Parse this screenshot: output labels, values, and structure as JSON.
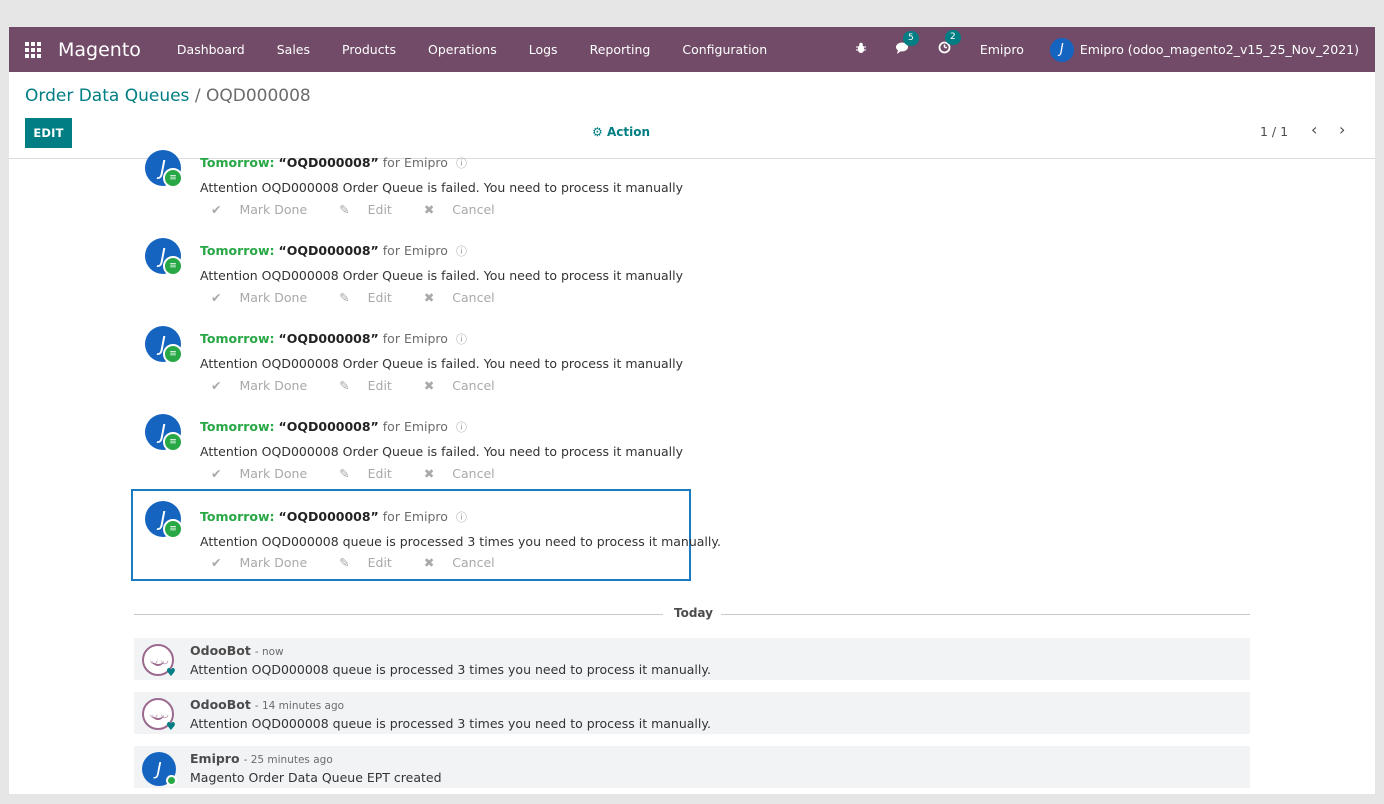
{
  "navbar": {
    "brand": "Magento",
    "menu": [
      "Dashboard",
      "Sales",
      "Products",
      "Operations",
      "Logs",
      "Reporting",
      "Configuration"
    ],
    "messages_badge": "5",
    "activities_badge": "2",
    "company": "Emipro",
    "user": "Emipro (odoo_magento2_v15_25_Nov_2021)"
  },
  "control": {
    "breadcrumb_parent": "Order Data Queues",
    "breadcrumb_sep": "/",
    "breadcrumb_current": "OQD000008",
    "edit_label": "EDIT",
    "action_label": "Action",
    "pager": "1 / 1"
  },
  "activities": [
    {
      "when": "Tomorrow:",
      "summary": "“OQD000008”",
      "for": "for Emipro",
      "note": "Attention OQD000008 Order Queue is failed. You need to process it manually"
    },
    {
      "when": "Tomorrow:",
      "summary": "“OQD000008”",
      "for": "for Emipro",
      "note": "Attention OQD000008 Order Queue is failed. You need to process it manually"
    },
    {
      "when": "Tomorrow:",
      "summary": "“OQD000008”",
      "for": "for Emipro",
      "note": "Attention OQD000008 Order Queue is failed. You need to process it manually"
    },
    {
      "when": "Tomorrow:",
      "summary": "“OQD000008”",
      "for": "for Emipro",
      "note": "Attention OQD000008 Order Queue is failed. You need to process it manually"
    },
    {
      "when": "Tomorrow:",
      "summary": "“OQD000008”",
      "for": "for Emipro",
      "note": "Attention OQD000008 queue is processed 3 times you need to process it manually."
    }
  ],
  "activity_tools": {
    "mark_done": "Mark Done",
    "edit": "Edit",
    "cancel": "Cancel"
  },
  "separator": "Today",
  "messages": [
    {
      "author": "OdooBot",
      "time": "- now",
      "body": "Attention OQD000008 queue is processed 3 times you need to process it manually."
    },
    {
      "author": "OdooBot",
      "time": "- 14 minutes ago",
      "body": "Attention OQD000008 queue is processed 3 times you need to process it manually."
    },
    {
      "author": "Emipro",
      "time": "- 25 minutes ago",
      "body": "Magento Order Data Queue EPT created"
    }
  ]
}
